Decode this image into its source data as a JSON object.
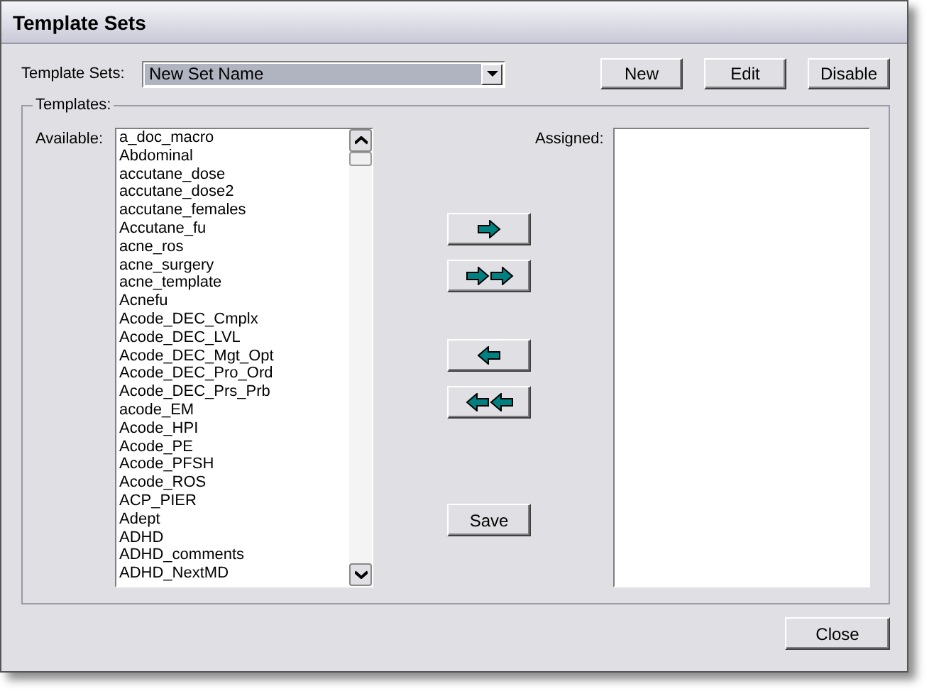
{
  "window": {
    "title": "Template Sets"
  },
  "template_sets": {
    "label": "Template Sets:",
    "value": "New Set Name"
  },
  "top_buttons": [
    "New",
    "Edit",
    "Disable"
  ],
  "templates": {
    "legend": "Templates:",
    "available_label": "Available:",
    "assigned_label": "Assigned:",
    "available": [
      "a_doc_macro",
      "Abdominal",
      "accutane_dose",
      "accutane_dose2",
      "accutane_females",
      "Accutane_fu",
      "acne_ros",
      "acne_surgery",
      "acne_template",
      "Acnefu",
      "Acode_DEC_Cmplx",
      "Acode_DEC_LVL",
      "Acode_DEC_Mgt_Opt",
      "Acode_DEC_Pro_Ord",
      "Acode_DEC_Prs_Prb",
      "acode_EM",
      "Acode_HPI",
      "Acode_PE",
      "Acode_PFSH",
      "Acode_ROS",
      "ACP_PIER",
      "Adept",
      "ADHD",
      "ADHD_comments",
      "ADHD_NextMD"
    ],
    "move_buttons": [
      {
        "kind": "add"
      },
      {
        "kind": "add_all"
      },
      {
        "kind": "remove"
      },
      {
        "kind": "remove_all"
      }
    ],
    "save": "Save"
  },
  "close": "Close"
}
